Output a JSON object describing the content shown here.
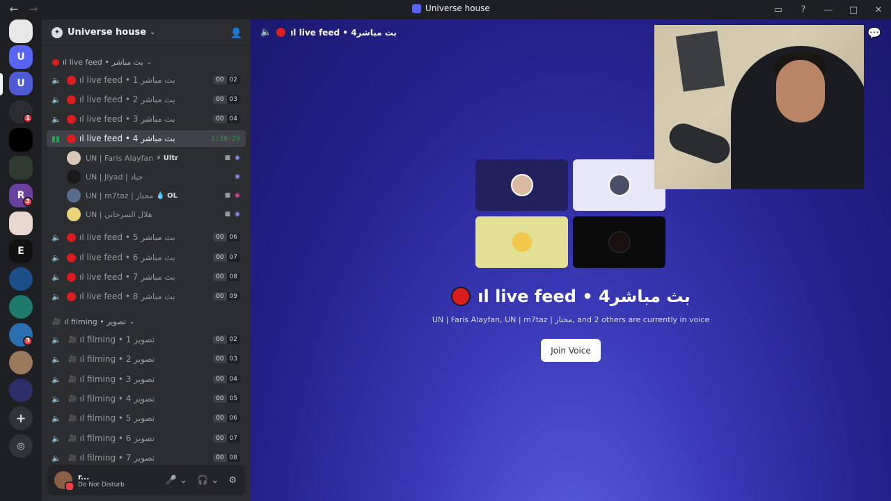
{
  "window": {
    "title": "Universe house"
  },
  "guild": {
    "name": "Universe house"
  },
  "categories": {
    "live": "ıl live feed • بث مباشر",
    "filming": "ıl filming • تصوير"
  },
  "live_channels": [
    {
      "name": "ıl live feed • بث مباشر 1",
      "c1": "00",
      "c2": "02"
    },
    {
      "name": "ıl live feed • بث مباشر 2",
      "c1": "00",
      "c2": "03"
    },
    {
      "name": "ıl live feed • بث مباشر 3",
      "c1": "00",
      "c2": "04"
    },
    {
      "name": "ıl live feed • بث مباشر 4",
      "timer": "1:39:29"
    },
    {
      "name": "ıl live feed • بث مباشر 5",
      "c1": "00",
      "c2": "06"
    },
    {
      "name": "ıl live feed • بث مباشر 6",
      "c1": "00",
      "c2": "07"
    },
    {
      "name": "ıl live feed • بث مباشر 7",
      "c1": "00",
      "c2": "08"
    },
    {
      "name": "ıl live feed • بث مباشر 8",
      "c1": "00",
      "c2": "09"
    }
  ],
  "voice_users": [
    {
      "name": "UN | Faris Alayfan",
      "tag": "⚡ Ultr"
    },
    {
      "name": "UN | Jiyad | جياد",
      "tag": ""
    },
    {
      "name": "UN | m7taz | محتاز",
      "tag": "💧 OL"
    },
    {
      "name": "UN | هلال السرحاني",
      "tag": ""
    }
  ],
  "filming_channels": [
    {
      "name": "ıl filming • تصوير 1",
      "c1": "00",
      "c2": "02"
    },
    {
      "name": "ıl filming • تصوير 2",
      "c1": "00",
      "c2": "03"
    },
    {
      "name": "ıl filming • تصوير 3",
      "c1": "00",
      "c2": "04"
    },
    {
      "name": "ıl filming • تصوير 4",
      "c1": "00",
      "c2": "05"
    },
    {
      "name": "ıl filming • تصوير 5",
      "c1": "00",
      "c2": "06"
    },
    {
      "name": "ıl filming • تصوير 6",
      "c1": "00",
      "c2": "07"
    },
    {
      "name": "ıl filming • تصوير 7",
      "c1": "00",
      "c2": "08"
    }
  ],
  "user_panel": {
    "name": "r...",
    "status": "Do Not Disturb"
  },
  "main": {
    "header": "ıl live feed • بث مباشر4",
    "big_title": "ıl live feed • بث مباشر4",
    "subtitle": "UN | Faris Alayfan, UN | m7taz | محتاز, and 2 others are currently in voice",
    "join_label": "Join Voice"
  },
  "server_badges": [
    "1",
    "2",
    "3"
  ],
  "colors": {
    "accent": "#5865f2",
    "live_dot": "#da1d1d",
    "speaking": "#23a55a"
  }
}
